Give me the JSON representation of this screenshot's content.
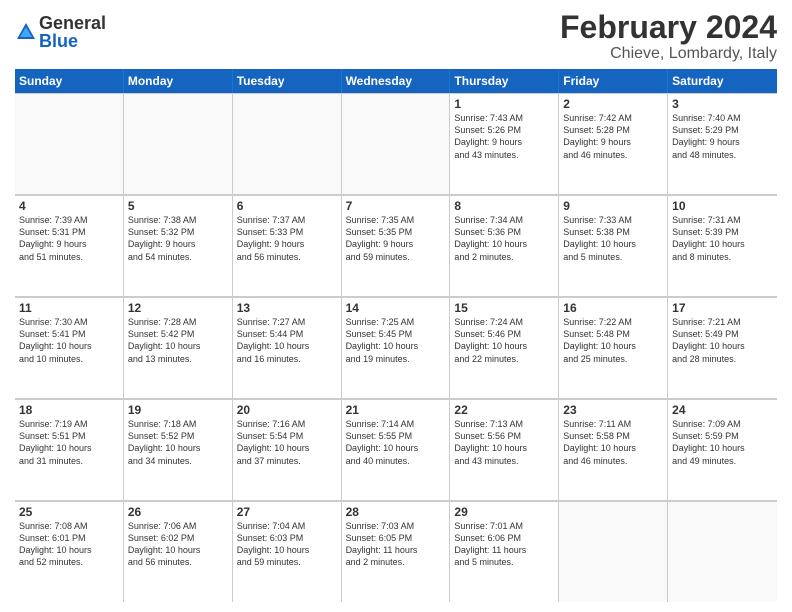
{
  "logo": {
    "general": "General",
    "blue": "Blue"
  },
  "title": {
    "month_year": "February 2024",
    "location": "Chieve, Lombardy, Italy"
  },
  "header_days": [
    "Sunday",
    "Monday",
    "Tuesday",
    "Wednesday",
    "Thursday",
    "Friday",
    "Saturday"
  ],
  "weeks": [
    [
      {
        "day": "",
        "info": ""
      },
      {
        "day": "",
        "info": ""
      },
      {
        "day": "",
        "info": ""
      },
      {
        "day": "",
        "info": ""
      },
      {
        "day": "1",
        "info": "Sunrise: 7:43 AM\nSunset: 5:26 PM\nDaylight: 9 hours\nand 43 minutes."
      },
      {
        "day": "2",
        "info": "Sunrise: 7:42 AM\nSunset: 5:28 PM\nDaylight: 9 hours\nand 46 minutes."
      },
      {
        "day": "3",
        "info": "Sunrise: 7:40 AM\nSunset: 5:29 PM\nDaylight: 9 hours\nand 48 minutes."
      }
    ],
    [
      {
        "day": "4",
        "info": "Sunrise: 7:39 AM\nSunset: 5:31 PM\nDaylight: 9 hours\nand 51 minutes."
      },
      {
        "day": "5",
        "info": "Sunrise: 7:38 AM\nSunset: 5:32 PM\nDaylight: 9 hours\nand 54 minutes."
      },
      {
        "day": "6",
        "info": "Sunrise: 7:37 AM\nSunset: 5:33 PM\nDaylight: 9 hours\nand 56 minutes."
      },
      {
        "day": "7",
        "info": "Sunrise: 7:35 AM\nSunset: 5:35 PM\nDaylight: 9 hours\nand 59 minutes."
      },
      {
        "day": "8",
        "info": "Sunrise: 7:34 AM\nSunset: 5:36 PM\nDaylight: 10 hours\nand 2 minutes."
      },
      {
        "day": "9",
        "info": "Sunrise: 7:33 AM\nSunset: 5:38 PM\nDaylight: 10 hours\nand 5 minutes."
      },
      {
        "day": "10",
        "info": "Sunrise: 7:31 AM\nSunset: 5:39 PM\nDaylight: 10 hours\nand 8 minutes."
      }
    ],
    [
      {
        "day": "11",
        "info": "Sunrise: 7:30 AM\nSunset: 5:41 PM\nDaylight: 10 hours\nand 10 minutes."
      },
      {
        "day": "12",
        "info": "Sunrise: 7:28 AM\nSunset: 5:42 PM\nDaylight: 10 hours\nand 13 minutes."
      },
      {
        "day": "13",
        "info": "Sunrise: 7:27 AM\nSunset: 5:44 PM\nDaylight: 10 hours\nand 16 minutes."
      },
      {
        "day": "14",
        "info": "Sunrise: 7:25 AM\nSunset: 5:45 PM\nDaylight: 10 hours\nand 19 minutes."
      },
      {
        "day": "15",
        "info": "Sunrise: 7:24 AM\nSunset: 5:46 PM\nDaylight: 10 hours\nand 22 minutes."
      },
      {
        "day": "16",
        "info": "Sunrise: 7:22 AM\nSunset: 5:48 PM\nDaylight: 10 hours\nand 25 minutes."
      },
      {
        "day": "17",
        "info": "Sunrise: 7:21 AM\nSunset: 5:49 PM\nDaylight: 10 hours\nand 28 minutes."
      }
    ],
    [
      {
        "day": "18",
        "info": "Sunrise: 7:19 AM\nSunset: 5:51 PM\nDaylight: 10 hours\nand 31 minutes."
      },
      {
        "day": "19",
        "info": "Sunrise: 7:18 AM\nSunset: 5:52 PM\nDaylight: 10 hours\nand 34 minutes."
      },
      {
        "day": "20",
        "info": "Sunrise: 7:16 AM\nSunset: 5:54 PM\nDaylight: 10 hours\nand 37 minutes."
      },
      {
        "day": "21",
        "info": "Sunrise: 7:14 AM\nSunset: 5:55 PM\nDaylight: 10 hours\nand 40 minutes."
      },
      {
        "day": "22",
        "info": "Sunrise: 7:13 AM\nSunset: 5:56 PM\nDaylight: 10 hours\nand 43 minutes."
      },
      {
        "day": "23",
        "info": "Sunrise: 7:11 AM\nSunset: 5:58 PM\nDaylight: 10 hours\nand 46 minutes."
      },
      {
        "day": "24",
        "info": "Sunrise: 7:09 AM\nSunset: 5:59 PM\nDaylight: 10 hours\nand 49 minutes."
      }
    ],
    [
      {
        "day": "25",
        "info": "Sunrise: 7:08 AM\nSunset: 6:01 PM\nDaylight: 10 hours\nand 52 minutes."
      },
      {
        "day": "26",
        "info": "Sunrise: 7:06 AM\nSunset: 6:02 PM\nDaylight: 10 hours\nand 56 minutes."
      },
      {
        "day": "27",
        "info": "Sunrise: 7:04 AM\nSunset: 6:03 PM\nDaylight: 10 hours\nand 59 minutes."
      },
      {
        "day": "28",
        "info": "Sunrise: 7:03 AM\nSunset: 6:05 PM\nDaylight: 11 hours\nand 2 minutes."
      },
      {
        "day": "29",
        "info": "Sunrise: 7:01 AM\nSunset: 6:06 PM\nDaylight: 11 hours\nand 5 minutes."
      },
      {
        "day": "",
        "info": ""
      },
      {
        "day": "",
        "info": ""
      }
    ]
  ]
}
